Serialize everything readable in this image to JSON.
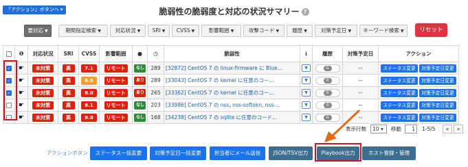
{
  "jump_button": "「アクション」ボタンへ ▾",
  "title": "脆弱性の脆弱度と対応の状況サマリー",
  "help_icon": "?",
  "filters": [
    {
      "label": "要対応",
      "active": true
    },
    {
      "label": "期間指定検索",
      "active": false
    },
    {
      "label": "対応状況",
      "active": false
    },
    {
      "label": "SRI",
      "active": false
    },
    {
      "label": "CVSS",
      "active": false
    },
    {
      "label": "影響範囲",
      "active": false
    },
    {
      "label": "攻撃コード",
      "active": false
    },
    {
      "label": "履歴",
      "active": false
    },
    {
      "label": "対策予定日",
      "active": false
    },
    {
      "label": "キーワード検索",
      "active": false
    }
  ],
  "reset_button": "リセット",
  "columns": {
    "check": "",
    "info": "",
    "status": "対応状況",
    "sri": "SRI",
    "cvss": "CVSS",
    "impact": "影響範囲",
    "exploit": "",
    "clock": "",
    "vulnerability": "脆弱性",
    "detail": "ℹ",
    "history": "履歴",
    "due": "対策予定日",
    "action": "アクション"
  },
  "rows": [
    {
      "checked": true,
      "status": "未対策",
      "sri": "高",
      "cvss": "7.1",
      "cvss_color": "#d9230f",
      "impact": "リモート",
      "exploit": "なし",
      "exploit_color": "#2e8b3a",
      "days": "289",
      "vulnerability": "[32872] CentOS 7 の linux-firmware に Blue...",
      "history": "0",
      "due": "--",
      "btn_status": "ステータス変更",
      "btn_due": "対策予定日変更"
    },
    {
      "checked": true,
      "status": "未対策",
      "sri": "高",
      "cvss": "6.5",
      "cvss_color": "#f0a030",
      "impact": "リモート",
      "exploit": "あり",
      "exploit_color": "#d9230f",
      "days": "289",
      "vulnerability": "[33043] CentOS 7 の kernel に任意のコー...",
      "history": "0",
      "due": "--",
      "btn_status": "ステータス変更",
      "btn_due": "対策予定日変更"
    },
    {
      "checked": true,
      "status": "未対策",
      "sri": "高",
      "cvss": "8.0",
      "cvss_color": "#d9230f",
      "impact": "リモート",
      "exploit": "あり",
      "exploit_color": "#d9230f",
      "days": "265",
      "vulnerability": "[33362] CentOS 7 の kernel に任意のコー...",
      "history": "0",
      "due": "--",
      "btn_status": "ステータス変更",
      "btn_due": "対策予定日変更"
    },
    {
      "checked": false,
      "status": "未対策",
      "sri": "高",
      "cvss": "8.1",
      "cvss_color": "#d9230f",
      "impact": "リモート",
      "exploit": "なし",
      "exploit_color": "#2e8b3a",
      "days": "203",
      "vulnerability": "[33986] CentOS 7 の nss, nss-softokn, nss-...",
      "history": "0",
      "due": "--",
      "btn_status": "ステータス変更",
      "btn_due": "対策予定日変更"
    },
    {
      "checked": false,
      "status": "未対策",
      "sri": "高",
      "cvss": "8.8",
      "cvss_color": "#d9230f",
      "impact": "リモート",
      "exploit": "なし",
      "exploit_color": "#2e8b3a",
      "days": "168",
      "vulnerability": "[34238] CentOS 7 の sqlite に任意のコード...",
      "history": "0",
      "due": "--",
      "btn_status": "ステータス変更",
      "btn_due": "対策予定日変更"
    }
  ],
  "pager": {
    "rows_label": "表示行数",
    "rows_value": "10",
    "move_label": "移動",
    "page_value": "1",
    "range": "1-5/5",
    "prev": "«",
    "next": "»"
  },
  "action_bar": {
    "label": "アクションボタン",
    "buttons": [
      "ステータス一括変更",
      "対策予定日一括変更",
      "担当者にメール送信",
      "JSON/TSV出力",
      "Playbook出力",
      "ホスト登録・管理"
    ]
  },
  "colors": {
    "accent": "#1a73e8",
    "danger": "#d9230f",
    "highlight": "#d10f1f"
  }
}
